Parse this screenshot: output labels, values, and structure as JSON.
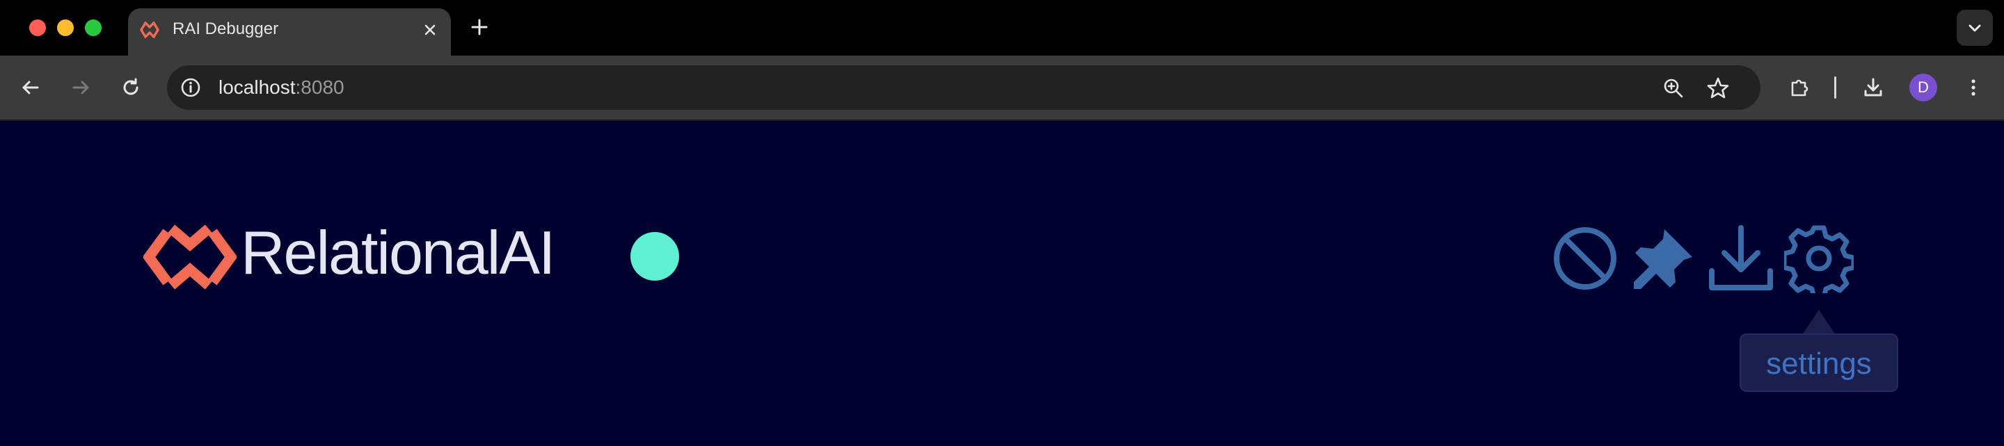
{
  "browser": {
    "tab": {
      "title": "RAI Debugger",
      "favicon": "relationalai-logo-icon"
    },
    "new_tab_icon": "plus-icon",
    "tab_search_icon": "chevron-down-icon",
    "address": {
      "host": "localhost",
      "port": ":8080"
    },
    "profile_initial": "D",
    "colors": {
      "close": "#fe5f57",
      "minimize": "#febc2e",
      "maximize": "#28c840",
      "avatar": "#7a4fd0"
    }
  },
  "app": {
    "logo": {
      "text_main": "Relational",
      "text_suffix": "AI",
      "mark_color": "#f26b55"
    },
    "status": {
      "color": "#5ef0d0"
    },
    "toolbar": {
      "icons": [
        "block-icon",
        "pin-icon",
        "download-icon",
        "gear-icon"
      ],
      "icon_color": "#3b6aa8"
    },
    "tooltip": {
      "text": "settings"
    },
    "background": "#020230"
  }
}
